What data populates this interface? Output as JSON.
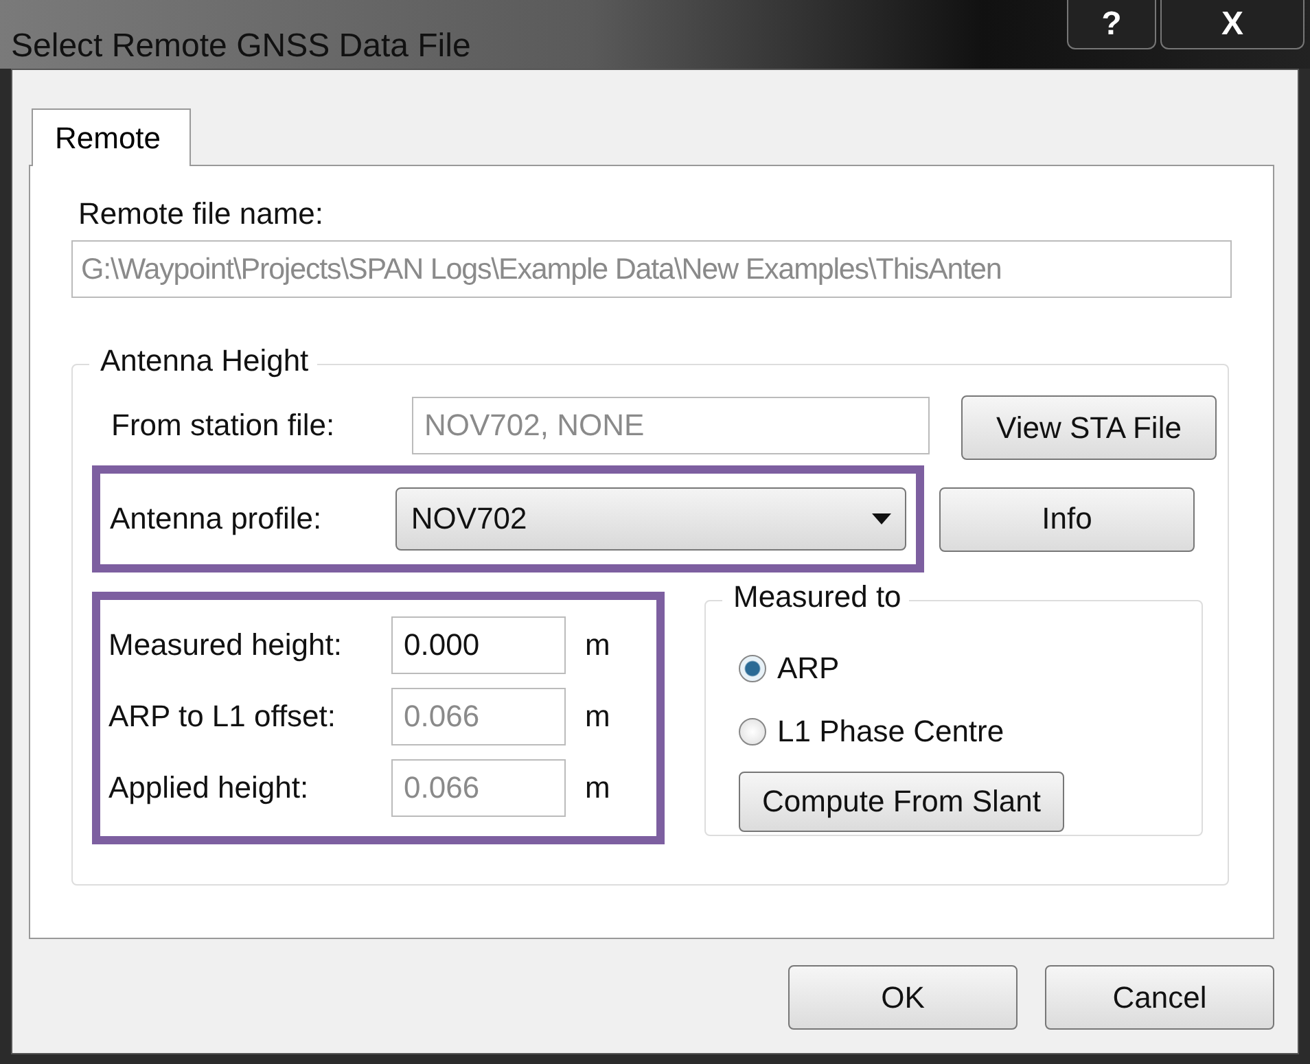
{
  "window": {
    "title": "Select Remote GNSS Data File",
    "help_button": "?",
    "close_button": "X"
  },
  "tabs": [
    {
      "label": "Remote",
      "selected": true
    }
  ],
  "remote_file": {
    "label": "Remote file name:",
    "value": "G:\\Waypoint\\Projects\\SPAN Logs\\Example Data\\New Examples\\ThisAnten",
    "disabled": true
  },
  "antenna_height": {
    "title": "Antenna Height",
    "station_file": {
      "label": "From station file:",
      "value": "NOV702, NONE",
      "disabled": true
    },
    "view_button": "View STA File",
    "profile": {
      "label": "Antenna profile:",
      "value": "NOV702"
    },
    "info_button": "Info",
    "heights": [
      {
        "label": "Measured height:",
        "value": "0.000",
        "unit": "m",
        "disabled": false
      },
      {
        "label": "ARP to L1 offset:",
        "value": "0.066",
        "unit": "m",
        "disabled": true
      },
      {
        "label": "Applied height:",
        "value": "0.066",
        "unit": "m",
        "disabled": true
      }
    ],
    "measured_to": {
      "title": "Measured to",
      "options": [
        {
          "label": "ARP",
          "selected": true
        },
        {
          "label": "L1 Phase Centre",
          "selected": false
        }
      ],
      "compute_button": "Compute From Slant"
    }
  },
  "buttons": [
    "OK",
    "Cancel"
  ]
}
